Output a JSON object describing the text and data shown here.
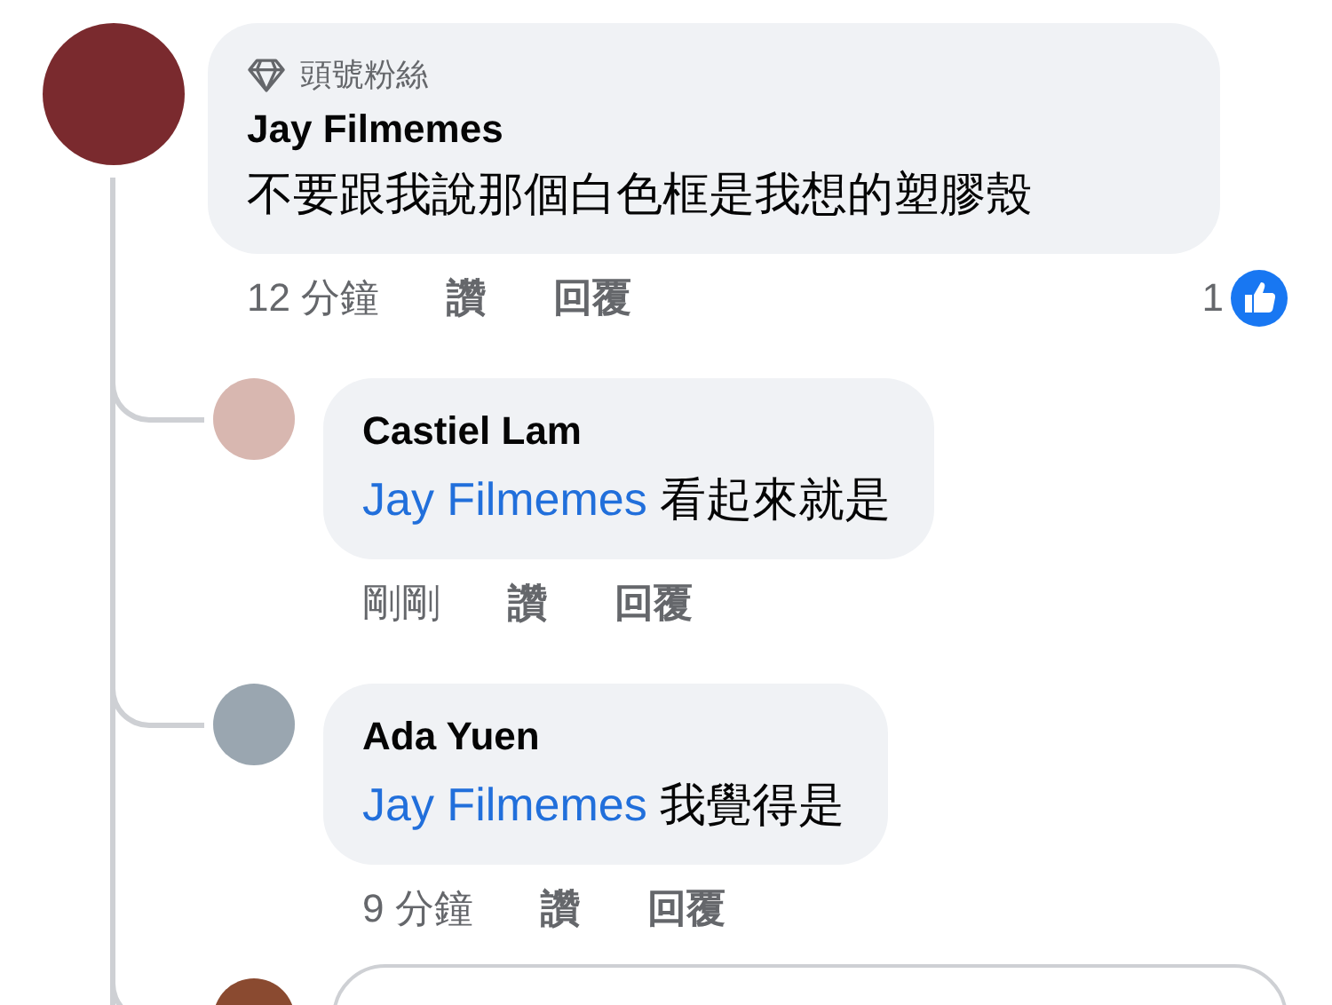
{
  "comment": {
    "badge": "頭號粉絲",
    "author": "Jay Filmemes",
    "text": "不要跟我說那個白色框是我想的塑膠殼",
    "time": "12 分鐘",
    "like": "讚",
    "reply": "回覆",
    "reaction_count": "1",
    "replies": [
      {
        "author": "Castiel Lam",
        "mention": "Jay Filmemes",
        "text": "看起來就是",
        "time": "剛剛",
        "like": "讚",
        "reply": "回覆"
      },
      {
        "author": "Ada Yuen",
        "mention": "Jay Filmemes",
        "text": "我覺得是",
        "time": "9 分鐘",
        "like": "讚",
        "reply": "回覆"
      }
    ]
  }
}
